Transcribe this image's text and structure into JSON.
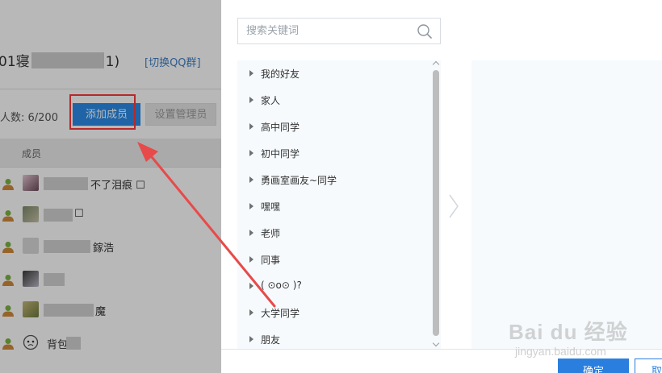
{
  "background": {
    "group_title_prefix": "01寝",
    "group_title_suffix": "1)",
    "switch_link": "[切换QQ群]",
    "member_count": "人数: 6/200",
    "add_member_button": "添加成员",
    "set_admin_button": "设置管理员",
    "members_header": "成员",
    "members": [
      {
        "visible_text": "不了泪痕 ☐"
      },
      {
        "visible_text": "☐"
      },
      {
        "visible_text": "鎵浩"
      },
      {
        "visible_text": ""
      },
      {
        "visible_text": "魔"
      },
      {
        "visible_text": "背包"
      }
    ]
  },
  "dialog": {
    "search": {
      "placeholder": "搜索关键词",
      "value": ""
    },
    "groups": [
      {
        "label": "我的好友"
      },
      {
        "label": "家人"
      },
      {
        "label": "高中同学"
      },
      {
        "label": "初中同学"
      },
      {
        "label": "勇画室画友~同学"
      },
      {
        "label": "嘿嘿"
      },
      {
        "label": "老师"
      },
      {
        "label": "同事"
      },
      {
        "label": "( ⊙o⊙ )?"
      },
      {
        "label": "大学同学"
      },
      {
        "label": "朋友"
      }
    ],
    "confirm_button": "确定",
    "cancel_button": "取"
  },
  "watermark": {
    "brand": "Bai du 经验",
    "url": "jingyan.baidu.com"
  },
  "colors": {
    "accent": "#2a8be6",
    "highlight": "#b52a2a",
    "arrow": "#e84a4a"
  }
}
